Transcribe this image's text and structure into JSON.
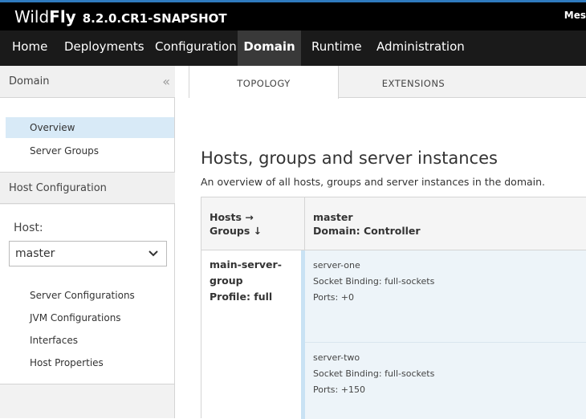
{
  "header": {
    "brand_wild": "Wild",
    "brand_fly": "Fly",
    "version": "8.2.0.CR1-SNAPSHOT",
    "user_truncated": "Mes"
  },
  "nav": {
    "items": [
      {
        "label": "Home",
        "active": false
      },
      {
        "label": "Deployments",
        "active": false
      },
      {
        "label": "Configuration",
        "active": false
      },
      {
        "label": "Domain",
        "active": true
      },
      {
        "label": "Runtime",
        "active": false
      },
      {
        "label": "Administration",
        "active": false
      }
    ]
  },
  "sidebar": {
    "title": "Domain",
    "collapse_icon": "double-chevron-left",
    "domain_links": [
      {
        "label": "Overview",
        "active": true
      },
      {
        "label": "Server Groups",
        "active": false
      }
    ],
    "host_section_title": "Host Configuration",
    "host_label": "Host:",
    "host_selected": "master",
    "host_links": [
      {
        "label": "Server Configurations"
      },
      {
        "label": "JVM Configurations"
      },
      {
        "label": "Interfaces"
      },
      {
        "label": "Host Properties"
      }
    ]
  },
  "tabs": [
    {
      "label": "TOPOLOGY",
      "active": true
    },
    {
      "label": "EXTENSIONS",
      "active": false
    }
  ],
  "content": {
    "title": "Hosts, groups and server instances",
    "description": "An overview of all hosts, groups and server instances in the domain.",
    "table": {
      "corner_line1": "Hosts →",
      "corner_line2": "Groups ↓",
      "host_name": "master",
      "host_role": "Domain: Controller",
      "group_name": "main-server-group",
      "group_profile": "Profile: full",
      "servers": [
        {
          "name": "server-one",
          "socket_binding": "Socket Binding: full-sockets",
          "ports": "Ports: +0"
        },
        {
          "name": "server-two",
          "socket_binding": "Socket Binding: full-sockets",
          "ports": "Ports: +150"
        }
      ]
    }
  },
  "colors": {
    "topbar": "#000000",
    "navbar": "#1a1a1a",
    "nav_active": "#393939",
    "sidebar_active": "#d8eaf7",
    "server_cell": "#edf4f9"
  }
}
